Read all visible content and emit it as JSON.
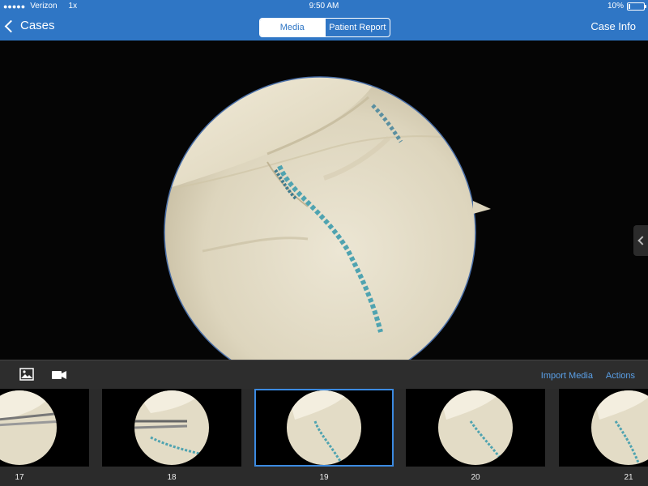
{
  "status_bar": {
    "signal": "●●●●●",
    "carrier": "Verizon",
    "network": "1x",
    "time": "9:50 AM",
    "battery_text": "10%",
    "battery_level": 0.1
  },
  "nav": {
    "back_label": "Cases",
    "tabs": [
      {
        "label": "Media",
        "active": true
      },
      {
        "label": "Patient Report",
        "active": false
      }
    ],
    "case_info_label": "Case Info"
  },
  "toolbar": {
    "photo_icon": "photo-icon",
    "video_icon": "video-camera-icon",
    "import_label": "Import Media",
    "actions_label": "Actions"
  },
  "thumbnails": [
    {
      "label": "17",
      "selected": false
    },
    {
      "label": "18",
      "selected": false
    },
    {
      "label": "19",
      "selected": true
    },
    {
      "label": "20",
      "selected": false
    },
    {
      "label": "21",
      "selected": false
    }
  ],
  "colors": {
    "nav_blue": "#2f76c5",
    "link_blue": "#5aa0e8",
    "selection_blue": "#3b8ae0"
  }
}
